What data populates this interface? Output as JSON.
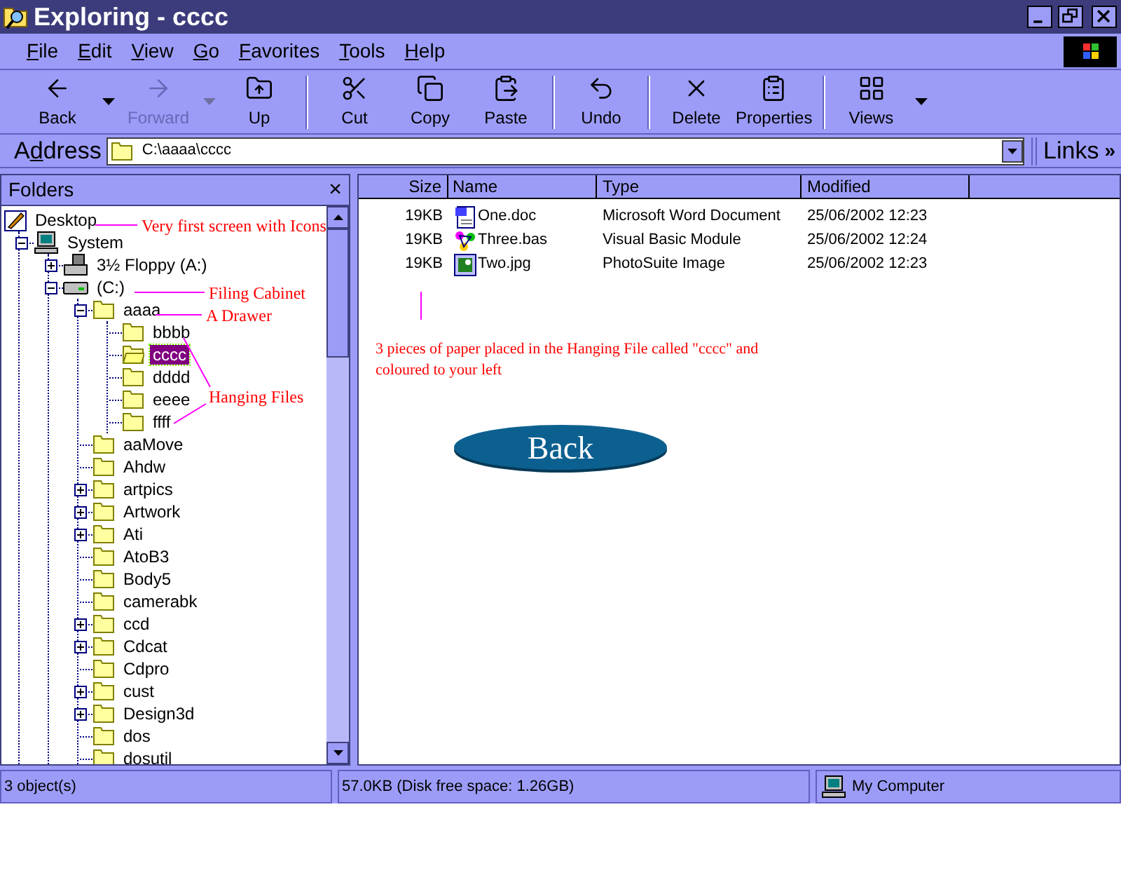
{
  "window": {
    "title": "Exploring - cccc"
  },
  "menu": [
    {
      "label": "File"
    },
    {
      "label": "Edit"
    },
    {
      "label": "View"
    },
    {
      "label": "Go"
    },
    {
      "label": "Favorites"
    },
    {
      "label": "Tools"
    },
    {
      "label": "Help"
    }
  ],
  "toolbar": [
    {
      "kind": "back",
      "label": "Back",
      "disabled": false,
      "dropdown": true
    },
    {
      "kind": "forward",
      "label": "Forward",
      "disabled": true,
      "dropdown": true
    },
    {
      "kind": "up",
      "label": "Up",
      "disabled": false,
      "dropdown": false
    },
    {
      "kind": "cut",
      "label": "Cut",
      "disabled": false,
      "dropdown": false
    },
    {
      "kind": "copy",
      "label": "Copy",
      "disabled": false,
      "dropdown": false
    },
    {
      "kind": "paste",
      "label": "Paste",
      "disabled": false,
      "dropdown": false
    },
    {
      "kind": "undo",
      "label": "Undo",
      "disabled": false,
      "dropdown": false
    },
    {
      "kind": "delete",
      "label": "Delete",
      "disabled": false,
      "dropdown": false
    },
    {
      "kind": "properties",
      "label": "Properties",
      "disabled": false,
      "dropdown": false
    },
    {
      "kind": "views",
      "label": "Views",
      "disabled": false,
      "dropdown": true
    }
  ],
  "address": {
    "label": "Address",
    "value": "C:\\aaaa\\cccc",
    "links": "Links",
    "more": "»"
  },
  "folders": {
    "title": "Folders",
    "close": "×",
    "tree": [
      {
        "label": "Desktop",
        "kind": "desktop",
        "selected": false,
        "children": [
          {
            "label": "System",
            "kind": "computer",
            "expanded": true,
            "selected": false,
            "children": [
              {
                "label": "3½ Floppy (A:)",
                "kind": "floppy",
                "expanded": false,
                "selected": false
              },
              {
                "label": "(C:)",
                "kind": "drive",
                "expanded": true,
                "selected": false,
                "children": [
                  {
                    "label": "aaaa",
                    "kind": "folder",
                    "expanded": true,
                    "selected": false,
                    "children": [
                      {
                        "label": "bbbb",
                        "kind": "folder",
                        "selected": false
                      },
                      {
                        "label": "cccc",
                        "kind": "folder",
                        "selected": true
                      },
                      {
                        "label": "dddd",
                        "kind": "folder",
                        "selected": false
                      },
                      {
                        "label": "eeee",
                        "kind": "folder",
                        "selected": false
                      },
                      {
                        "label": "ffff",
                        "kind": "folder",
                        "selected": false
                      }
                    ]
                  },
                  {
                    "label": "aaMove",
                    "kind": "folder",
                    "selected": false
                  },
                  {
                    "label": "Ahdw",
                    "kind": "folder",
                    "selected": false
                  },
                  {
                    "label": "artpics",
                    "kind": "folder",
                    "expanded": false,
                    "selected": false
                  },
                  {
                    "label": "Artwork",
                    "kind": "folder",
                    "expanded": false,
                    "selected": false
                  },
                  {
                    "label": "Ati",
                    "kind": "folder",
                    "expanded": false,
                    "selected": false
                  },
                  {
                    "label": "AtoB3",
                    "kind": "folder",
                    "selected": false
                  },
                  {
                    "label": "Body5",
                    "kind": "folder",
                    "selected": false
                  },
                  {
                    "label": "camerabk",
                    "kind": "folder",
                    "selected": false
                  },
                  {
                    "label": "ccd",
                    "kind": "folder",
                    "expanded": false,
                    "selected": false
                  },
                  {
                    "label": "Cdcat",
                    "kind": "folder",
                    "expanded": false,
                    "selected": false
                  },
                  {
                    "label": "Cdpro",
                    "kind": "folder",
                    "selected": false
                  },
                  {
                    "label": "cust",
                    "kind": "folder",
                    "expanded": false,
                    "selected": false
                  },
                  {
                    "label": "Design3d",
                    "kind": "folder",
                    "expanded": false,
                    "selected": false
                  },
                  {
                    "label": "dos",
                    "kind": "folder",
                    "selected": false
                  },
                  {
                    "label": "dosutil",
                    "kind": "folder",
                    "selected": false
                  }
                ]
              }
            ]
          }
        ]
      }
    ],
    "annotations": [
      "Very first screen with Icons",
      "Filing Cabinet",
      "A Drawer",
      "Hanging Files"
    ]
  },
  "files": {
    "columns": [
      "Size",
      "Name",
      "Type",
      "Modified"
    ],
    "rows": [
      {
        "size": "19KB",
        "name": "One.doc",
        "kind": "doc",
        "type": "Microsoft Word Document",
        "modified": "25/06/2002 12:23"
      },
      {
        "size": "19KB",
        "name": "Three.bas",
        "kind": "bas",
        "type": "Visual Basic Module",
        "modified": "25/06/2002 12:24"
      },
      {
        "size": "19KB",
        "name": "Two.jpg",
        "kind": "jpg",
        "type": "PhotoSuite Image",
        "modified": "25/06/2002 12:23"
      }
    ],
    "note": "3 pieces of paper placed in the Hanging File called \"cccc\" and coloured to your left",
    "back_button": "Back"
  },
  "status_bar": {
    "objects": "3 object(s)",
    "size": "57.0KB (Disk free space: 1.26GB)",
    "zone": "My Computer"
  }
}
